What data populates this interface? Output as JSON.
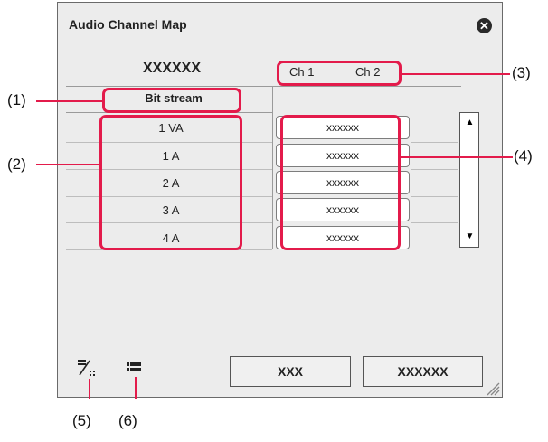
{
  "window": {
    "title": "Audio Channel Map",
    "close_glyph": "✕"
  },
  "header": {
    "name": "XXXXXX",
    "channels": [
      "Ch 1",
      "Ch 2"
    ]
  },
  "bitstream_label": "Bit stream",
  "rows": [
    {
      "label": "1 VA",
      "value": "xxxxxx"
    },
    {
      "label": "1 A",
      "value": "xxxxxx"
    },
    {
      "label": "2 A",
      "value": "xxxxxx"
    },
    {
      "label": "3 A",
      "value": "xxxxxx"
    },
    {
      "label": "4 A",
      "value": "xxxxxx"
    }
  ],
  "scrollbar": {
    "up_glyph": "▲",
    "down_glyph": "▼"
  },
  "footer": {
    "ok_label": "XXX",
    "cancel_label": "XXXXXX"
  },
  "icons": {
    "left": "map-auto-icon",
    "right": "list-icon"
  },
  "callouts": [
    "(1)",
    "(2)",
    "(3)",
    "(4)",
    "(5)",
    "(6)"
  ],
  "colors": {
    "highlight": "#e31b4b",
    "dialog_bg": "#ececec"
  }
}
